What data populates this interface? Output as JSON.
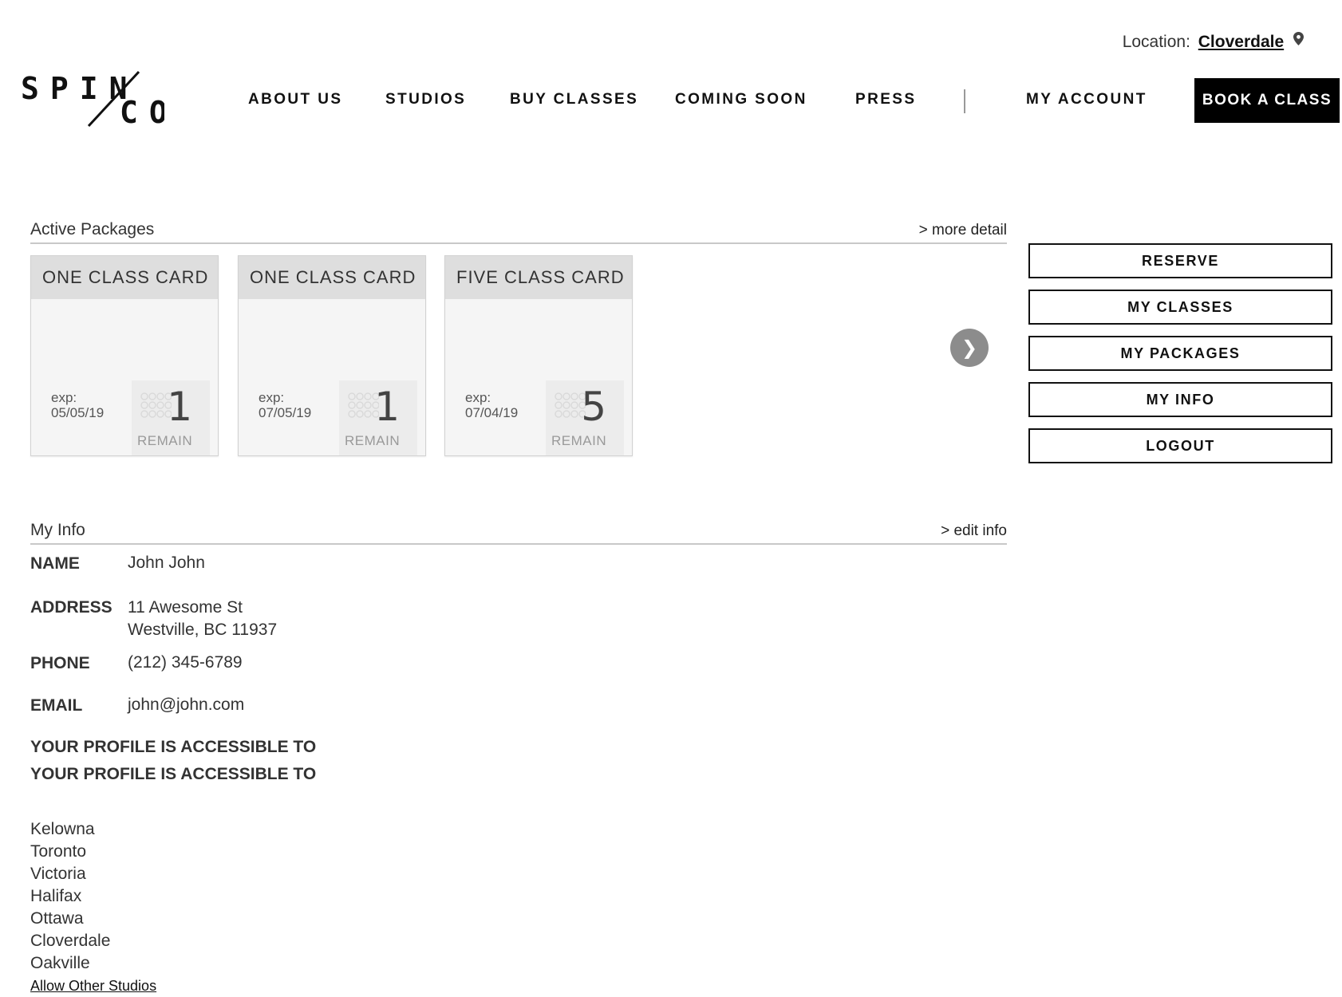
{
  "location": {
    "label": "Location:",
    "value": "Cloverdale",
    "icon": "map-pin-icon"
  },
  "brand": {
    "logo_text": "SPIN/CO",
    "logo_top": "SPIN",
    "logo_bottom": "CO"
  },
  "nav": {
    "items": [
      "ABOUT US",
      "STUDIOS",
      "BUY CLASSES",
      "COMING SOON",
      "PRESS"
    ],
    "account": "MY ACCOUNT",
    "cta": "BOOK A CLASS"
  },
  "packages": {
    "title": "Active Packages",
    "link": "> more detail",
    "cards": [
      {
        "name": "ONE CLASS CARD",
        "exp_label": "exp:",
        "exp_date": "05/05/19",
        "count": "1",
        "remain_label": "REMAIN"
      },
      {
        "name": "ONE CLASS CARD",
        "exp_label": "exp:",
        "exp_date": "07/05/19",
        "count": "1",
        "remain_label": "REMAIN"
      },
      {
        "name": "FIVE CLASS CARD",
        "exp_label": "exp:",
        "exp_date": "07/04/19",
        "count": "5",
        "remain_label": "REMAIN"
      }
    ],
    "next_icon": "❯"
  },
  "sidebar": {
    "buttons": [
      "RESERVE",
      "MY CLASSES",
      "MY PACKAGES",
      "MY INFO",
      "LOGOUT"
    ]
  },
  "info": {
    "title": "My Info",
    "link": "> edit info",
    "name_label": "NAME",
    "name": "John John",
    "address_label": "ADDRESS",
    "address_line1": "11 Awesome St",
    "address_line2": "Westville, BC 11937",
    "phone_label": "PHONE",
    "phone": "(212) 345-6789",
    "email_label": "EMAIL",
    "email": "john@john.com",
    "access_heading_1": "YOUR PROFILE IS ACCESSIBLE TO",
    "access_heading_2": "YOUR PROFILE IS ACCESSIBLE TO",
    "studios": [
      "Kelowna",
      "Toronto",
      "Victoria",
      "Halifax",
      "Ottawa",
      "Cloverdale",
      "Oakville"
    ],
    "allow_link": "Allow Other Studios"
  }
}
